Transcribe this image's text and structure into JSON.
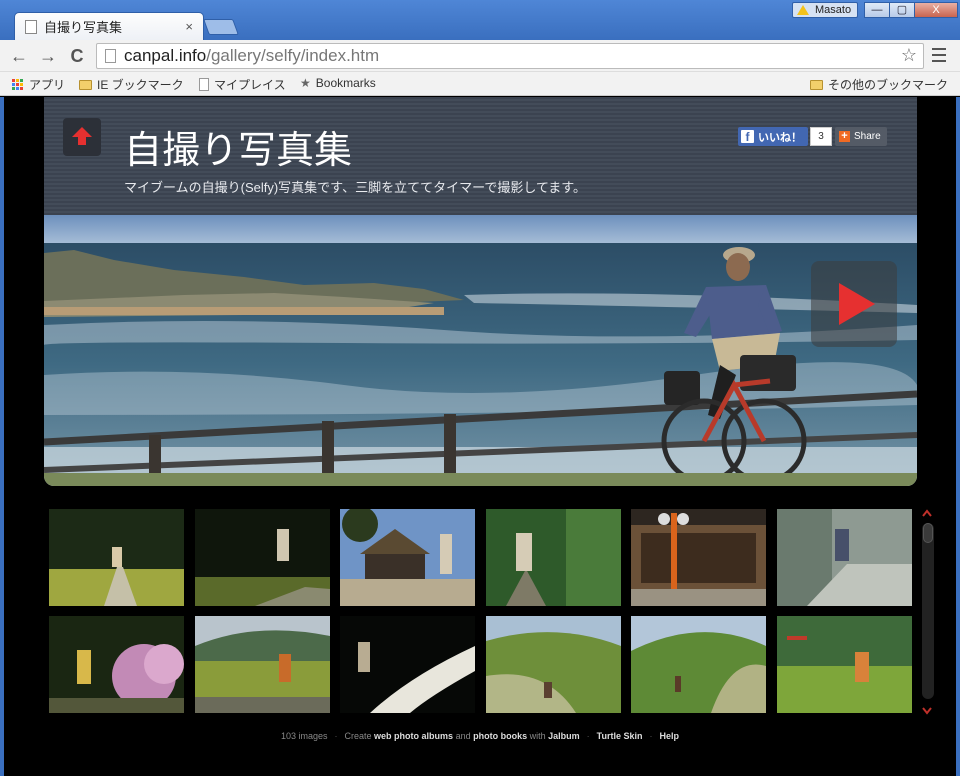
{
  "browser": {
    "tab_title": "自撮り写真集",
    "tab_close": "×",
    "user_name": "Masato",
    "win_min": "—",
    "win_max": "▢",
    "win_close": "X",
    "url_domain": "canpal.info",
    "url_path": "/gallery/selfy/index.htm",
    "back": "←",
    "forward": "→",
    "reload": "C",
    "star": "☆",
    "bookmarks": [
      "アプリ",
      "IE ブックマーク",
      "マイプレイス",
      "Bookmarks"
    ],
    "other_bookmarks": "その他のブックマーク",
    "bookmark_star": "★"
  },
  "gallery": {
    "title": "自撮り写真集",
    "subtitle": "マイブームの自撮り(Selfy)写真集です、三脚を立ててタイマーで撮影してます。",
    "fb_like": "いいね！",
    "fb_f": "f",
    "fb_count": "3",
    "share_plus": "+",
    "share": "Share"
  },
  "footer": {
    "count": "103 images",
    "create": "Create",
    "web_photo_albums": "web photo albums",
    "and": "and",
    "photo_books": "photo books",
    "with": "with",
    "jalbum": "Jalbum",
    "skin": "Turtle Skin",
    "help": "Help",
    "dot": "·"
  },
  "colors": {
    "accent_red": "#e63030",
    "window_blue": "#3a6fbf",
    "header_gray": "#3f4754"
  },
  "icons": [
    "warning-icon",
    "up-arrow-icon",
    "play-icon",
    "star-icon",
    "folder-icon",
    "apps-icon"
  ]
}
